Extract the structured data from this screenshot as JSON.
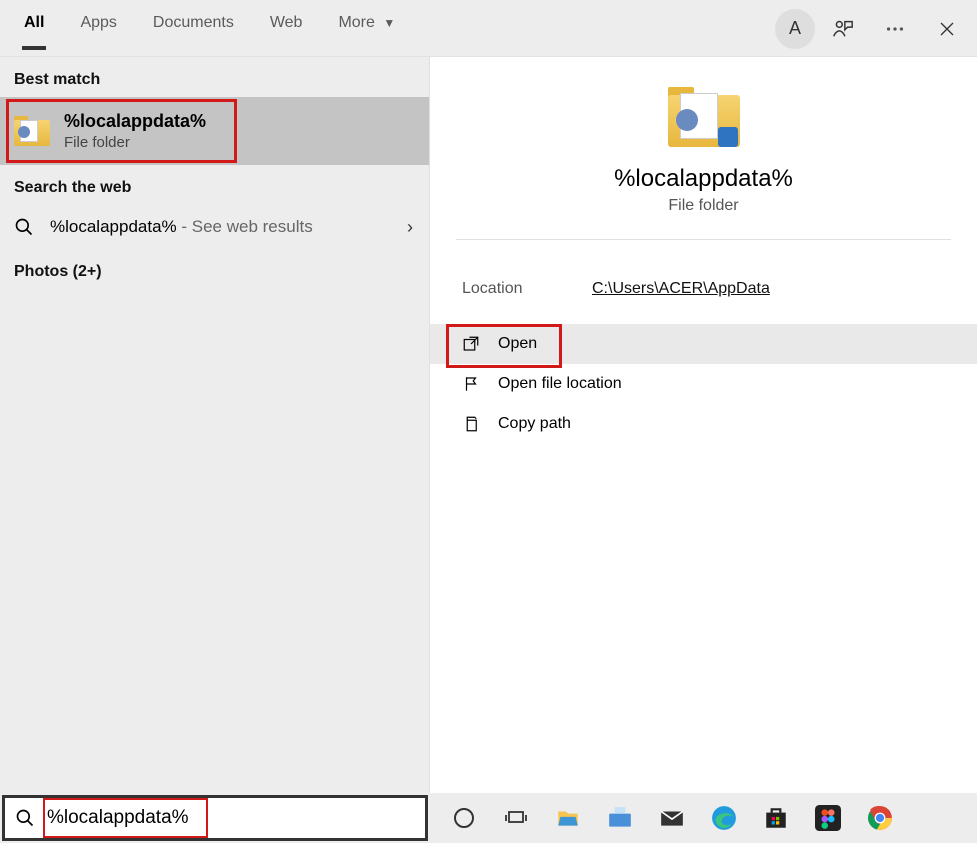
{
  "tabs": {
    "all": "All",
    "apps": "Apps",
    "documents": "Documents",
    "web": "Web",
    "more": "More"
  },
  "avatar_letter": "A",
  "left": {
    "best_match_label": "Best match",
    "best_match": {
      "title": "%localappdata%",
      "subtitle": "File folder"
    },
    "search_web_label": "Search the web",
    "web_result": {
      "query": "%localappdata%",
      "suffix": " - See web results"
    },
    "photos_label": "Photos (2+)"
  },
  "preview": {
    "title": "%localappdata%",
    "subtitle": "File folder",
    "location_label": "Location",
    "location_value": "C:\\Users\\ACER\\AppData",
    "actions": {
      "open": "Open",
      "open_loc": "Open file location",
      "copy_path": "Copy path"
    }
  },
  "search_value": "%localappdata%"
}
